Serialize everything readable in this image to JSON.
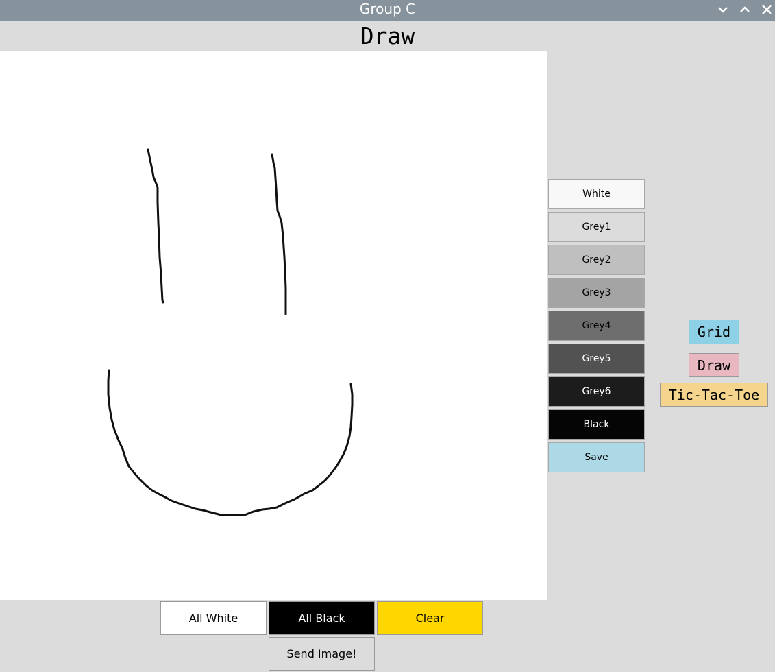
{
  "window": {
    "title": "Group C",
    "controls": [
      "chevron-down-icon",
      "chevron-up-icon",
      "close-icon"
    ]
  },
  "heading": "Draw",
  "palette": [
    {
      "label": "White",
      "bg": "#f8f8f8",
      "fg": "#000000"
    },
    {
      "label": "Grey1",
      "bg": "#dcdcdc",
      "fg": "#000000"
    },
    {
      "label": "Grey2",
      "bg": "#bfbfbf",
      "fg": "#000000"
    },
    {
      "label": "Grey3",
      "bg": "#a4a4a4",
      "fg": "#000000"
    },
    {
      "label": "Grey4",
      "bg": "#6e6e6e",
      "fg": "#000000"
    },
    {
      "label": "Grey5",
      "bg": "#525252",
      "fg": "#ffffff"
    },
    {
      "label": "Grey6",
      "bg": "#1c1c1c",
      "fg": "#ffffff"
    },
    {
      "label": "Black",
      "bg": "#050505",
      "fg": "#ffffff"
    },
    {
      "label": "Save",
      "bg": "#add8e6",
      "fg": "#000000"
    }
  ],
  "modes": {
    "grid": {
      "label": "Grid",
      "bg": "#8ed0e6"
    },
    "draw": {
      "label": "Draw",
      "bg": "#e8b7c0"
    },
    "tictactoe": {
      "label": "Tic-Tac-Toe",
      "bg": "#f5d48e"
    }
  },
  "bottom": {
    "all_white": {
      "label": "All White",
      "bg": "#ffffff",
      "fg": "#000000"
    },
    "all_black": {
      "label": "All Black",
      "bg": "#000000",
      "fg": "#ffffff"
    },
    "clear": {
      "label": "Clear",
      "bg": "#ffd700",
      "fg": "#000000"
    },
    "send": {
      "label": "Send Image!",
      "bg": "#dcdcdc",
      "fg": "#000000"
    }
  },
  "stroke_color": "#111111"
}
